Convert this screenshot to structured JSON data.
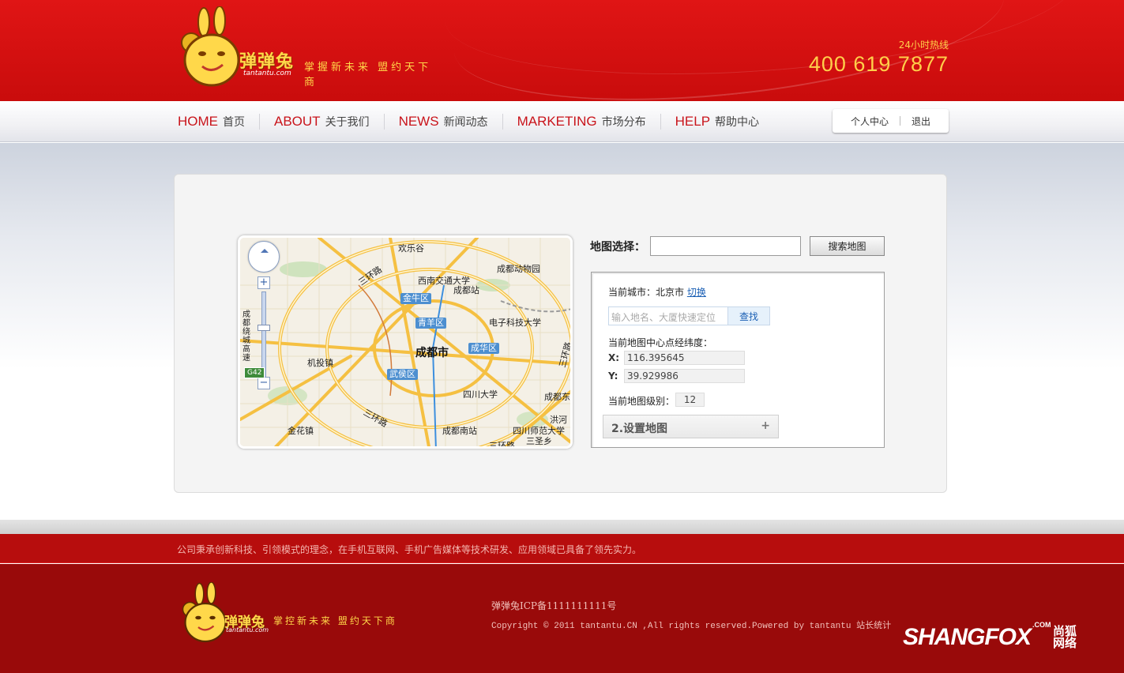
{
  "header": {
    "brand": "弹弹兔",
    "domain": "tantantu.com",
    "slogan": "掌握新未来 盟约天下商",
    "hotline_label": "24小时热线",
    "hotline": "400 619 7877"
  },
  "nav": {
    "items": [
      {
        "en": "HOME",
        "cn": "首页"
      },
      {
        "en": "ABOUT",
        "cn": "关于我们"
      },
      {
        "en": "NEWS",
        "cn": "新闻动态"
      },
      {
        "en": "MARKETING",
        "cn": "市场分布"
      },
      {
        "en": "HELP",
        "cn": "帮助中心"
      }
    ],
    "user_center": "个人中心",
    "logout": "退出"
  },
  "map": {
    "labels": {
      "huanle": "欢乐谷",
      "zoo": "成都动物园",
      "swjtu": "西南交通大学",
      "station": "成都站",
      "jinniu": "金牛区",
      "qingyang": "青羊区",
      "uestc": "电子科技大学",
      "city": "成都市",
      "chenghua": "成华区",
      "jitou": "机投镇",
      "wuhou": "武侯区",
      "scu": "四川大学",
      "east": "成都东",
      "ring_west": "成都绕城高速",
      "ring3": "三环路",
      "ring3b": "三环路",
      "ring3c": "三环路",
      "ring3d": "三环路",
      "jinhua": "金花镇",
      "south": "成都南站",
      "normal": "四川师范大学",
      "hongjia": "洪河",
      "sansheng": "三圣乡",
      "shield": "G42"
    }
  },
  "search": {
    "label": "地图选择：",
    "value": "",
    "button": "搜索地图"
  },
  "panel": {
    "city_prefix": "当前城市：北京市",
    "switch": "切换",
    "place_placeholder": "输入地名、大厦快速定位",
    "find": "查找",
    "center_label": "当前地图中心点经纬度：",
    "x_label": "X:",
    "x_value": "116.395645",
    "y_label": "Y:",
    "y_value": "39.929986",
    "level_label": "当前地图级别：",
    "level_value": "12",
    "set_map": "2.设置地图",
    "plus": "+"
  },
  "footer": {
    "tagline": "公司秉承创新科技、引领模式的理念，在手机互联网、手机广告媒体等技术研发、应用领域已具备了领先实力。",
    "brand": "弹弹兔",
    "domain": "tantantu.com",
    "slogan": "掌控新未来 盟约天下商",
    "icp": "弹弹兔ICP备1111111111号",
    "copyright": "Copyright © 2011 tantantu.CN ,All rights reserved.Powered by tantantu 站长统计",
    "shangfox": "SHANGFOX",
    "shangfox_com": ".COM",
    "shangfox_cn": "尚狐网络"
  },
  "colors": {
    "brand_red": "#c9141b",
    "gold": "#ffcf4a",
    "footer_red": "#990a0a"
  }
}
